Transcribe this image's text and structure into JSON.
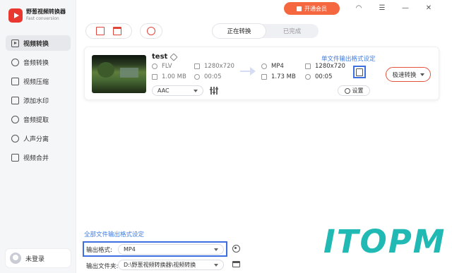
{
  "app": {
    "name": "野葱视频转换器",
    "subtitle": "Fast conversion"
  },
  "header": {
    "vip_label": "开通会员",
    "status_tabs": [
      {
        "label": "正在转换",
        "active": true
      },
      {
        "label": "已完成",
        "active": false
      }
    ],
    "tool_icons": [
      "add-file-icon",
      "add-folder-icon",
      "web-icon"
    ]
  },
  "sidebar": {
    "items": [
      {
        "label": "视频转换",
        "icon": "video-convert-icon",
        "active": true
      },
      {
        "label": "音频转换",
        "icon": "audio-convert-icon",
        "active": false
      },
      {
        "label": "视频压缩",
        "icon": "video-compress-icon",
        "active": false
      },
      {
        "label": "添加水印",
        "icon": "watermark-icon",
        "active": false
      },
      {
        "label": "音频提取",
        "icon": "audio-extract-icon",
        "active": false
      },
      {
        "label": "人声分离",
        "icon": "vocal-separate-icon",
        "active": false
      },
      {
        "label": "视频合并",
        "icon": "video-merge-icon",
        "active": false
      }
    ],
    "login_label": "未登录"
  },
  "file_card": {
    "name": "test",
    "source": {
      "format": "FLV",
      "resolution": "1280x720",
      "size": "1.00 MB",
      "duration": "00:05"
    },
    "target": {
      "format": "MP4",
      "resolution": "1280x720",
      "size": "1.73 MB",
      "duration": "00:05"
    },
    "audio_codec": "AAC",
    "single_format_link": "单文件输出格式设定",
    "settings_label": "设置",
    "convert_button": "极速转换"
  },
  "footer": {
    "all_format_link": "全部文件输出格式设定",
    "output_format_label": "输出格式:",
    "output_format_value": "MP4",
    "output_folder_label": "输出文件夹:",
    "output_folder_value": "D:\\野葱视频转换器\\视频转换"
  },
  "watermark_text": "ITOPM",
  "colors": {
    "brand": "#e8382f",
    "vip": "#f4673f",
    "link": "#3d7be3",
    "highlight": "#3d6fe0",
    "watermark": "#21b9b4"
  }
}
